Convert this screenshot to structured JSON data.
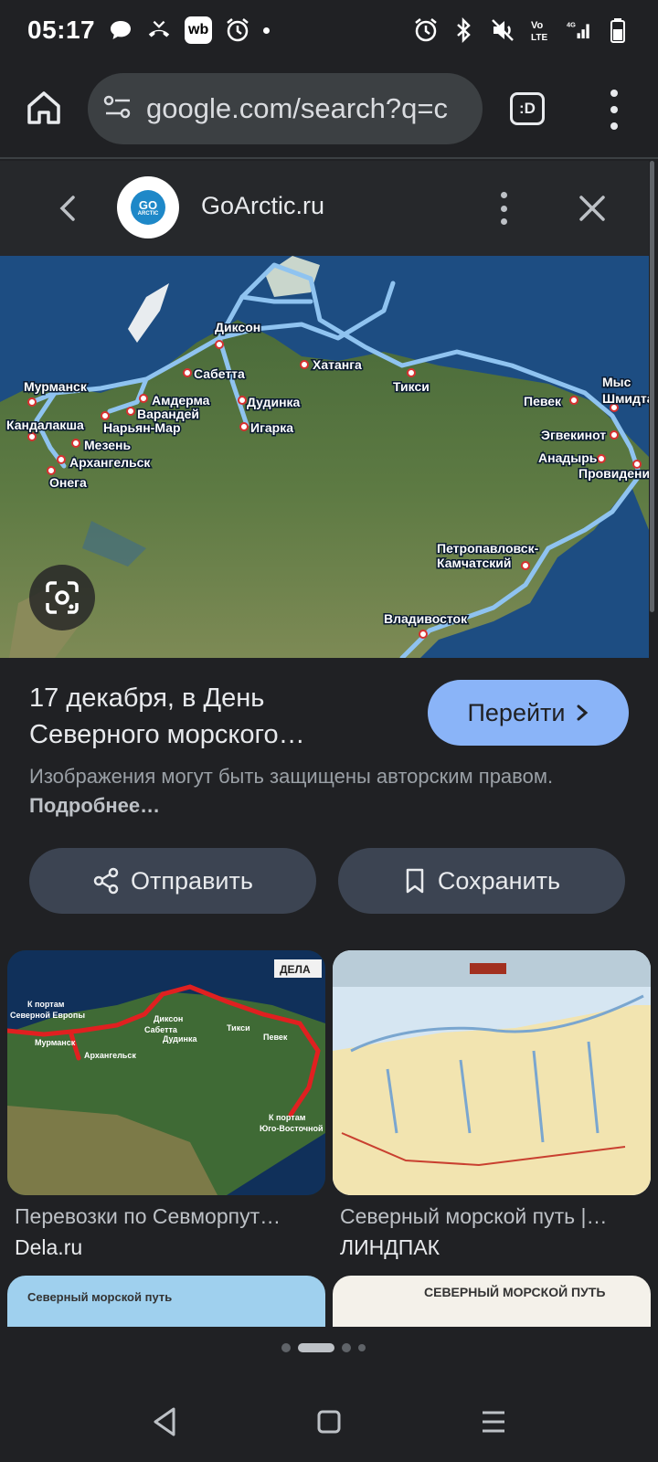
{
  "status_bar": {
    "time": "05:17",
    "app_badge": "wb"
  },
  "browser": {
    "url": "google.com/search?q=c",
    "tabs_label": ":D"
  },
  "source": {
    "name": "GoArctic.ru",
    "logo_text_top": "GO",
    "logo_text_bottom": "ARCTIC"
  },
  "map_labels": {
    "murmansk": "Мурманск",
    "kandalaksha": "Кандалакша",
    "onega": "Онега",
    "arkhangelsk": "Архангельск",
    "mezen": "Мезень",
    "naryan_mar": "Нарьян-Мар",
    "varandey": "Варандей",
    "amderma": "Амдерма",
    "sabetta": "Сабетта",
    "dikson": "Диксон",
    "dudinka": "Дудинка",
    "igarka": "Игарка",
    "khatanga": "Хатанга",
    "tiksi": "Тикси",
    "pevek": "Певек",
    "mys_shmidta_1": "Мыс",
    "mys_shmidta_2": "Шмидта",
    "egvekinot": "Эгвекинот",
    "anadyr": "Анадырь",
    "provideniya": "Провидения",
    "petropavlovsk_1": "Петропавловск-",
    "petropavlovsk_2": "Камчатский",
    "vladivostok": "Владивосток"
  },
  "caption": {
    "title": "17 декабря, в День Северного морского…",
    "visit_label": "Перейти",
    "copyright_text": "Изображения могут быть защищены авторским правом. ",
    "copyright_link": "Подробнее…"
  },
  "actions": {
    "share_label": "Отправить",
    "save_label": "Сохранить"
  },
  "related": [
    {
      "title": "Перевозки по Севморпут…",
      "source": "Dela.ru",
      "badge": "ДЕЛА",
      "map_labels": [
        "К портам",
        "Северной Европы",
        "Мурманск",
        "Архангельск",
        "Диксон",
        "Сабетта",
        "Дудинка",
        "Тикси",
        "Певек",
        "К портам",
        "Юго-Восточной Азии"
      ]
    },
    {
      "title": "Северный морской путь |…",
      "source": "ЛИНДПАК"
    },
    {
      "header_text": "Северный морской путь"
    },
    {
      "header_text": "СЕВЕРНЫЙ МОРСКОЙ ПУТЬ"
    }
  ],
  "colors": {
    "background": "#202124",
    "accent_button": "#8ab4f8",
    "secondary_button": "#3c4452",
    "route_blue": "#8fc3f0",
    "route_red": "#e02020"
  }
}
